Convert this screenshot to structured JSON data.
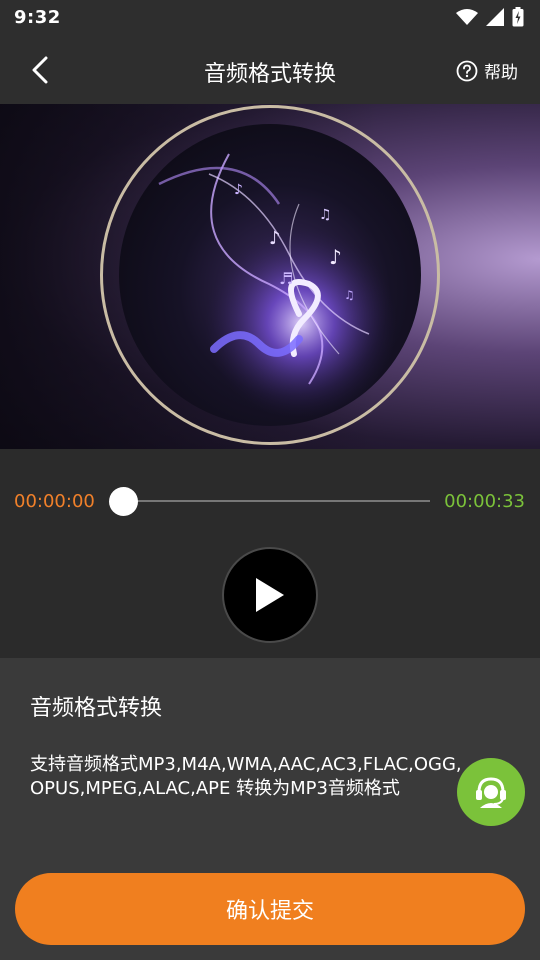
{
  "status_bar": {
    "time": "9:32",
    "icons": [
      "wifi-icon",
      "cell-signal-icon",
      "battery-icon"
    ]
  },
  "nav": {
    "back_icon": "chevron-left-icon",
    "title": "音频格式转换",
    "help_icon": "question-circle-icon",
    "help_label": "帮助"
  },
  "player": {
    "time_current": "00:00:00",
    "time_total": "00:00:33",
    "progress": 0,
    "play_icon": "play-icon"
  },
  "info": {
    "title": "音频格式转换",
    "description": "支持音频格式MP3,M4A,WMA,AAC,AC3,FLAC,OGG,OPUS,MPEG,ALAC,APE 转换为MP3音频格式",
    "support_icon": "customer-service-headset-icon"
  },
  "actions": {
    "confirm_label": "确认提交"
  },
  "colors": {
    "accent_orange": "#f07f1f",
    "accent_green": "#7bc23a",
    "background": "#2b2b2b",
    "panel": "#3a3a3a"
  }
}
